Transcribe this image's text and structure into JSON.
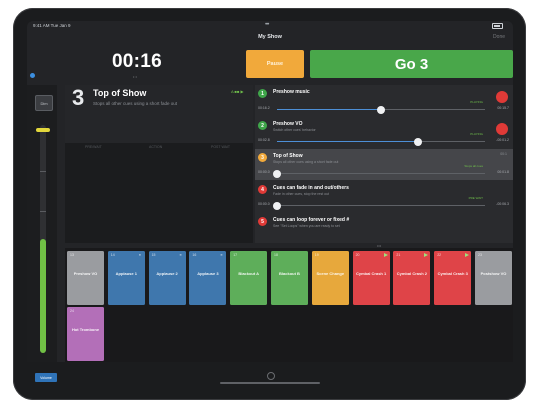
{
  "status_bar": {
    "time": "9:41 AM  Tue Jan 9",
    "dots": "•••"
  },
  "header": {
    "show_name": "My Show",
    "done_label": "Done",
    "clock": "00:16",
    "clock_dots": "• •"
  },
  "controls": {
    "pause_label": "Pause",
    "go_label": "Go 3"
  },
  "sidebar": {
    "dim_label": "Dim"
  },
  "current_cue": {
    "number": "3",
    "title": "Top of Show",
    "description": "Stops all other cues using a short fade out",
    "status": "A ■■ ▶",
    "columns": [
      "PRE/WAIT",
      "ACTION",
      "POST WAIT"
    ]
  },
  "cue_list": [
    {
      "number": "1",
      "color": "#3fa64a",
      "title": "Preshow music",
      "subtitle": "",
      "state": "PLAYING",
      "left_time": "00:16.2",
      "right_time": "00:15.7",
      "progress": 0.5,
      "action": "stop",
      "active": false
    },
    {
      "number": "2",
      "color": "#3fa64a",
      "title": "Preshow VO",
      "subtitle": "Switch other cues' behavior",
      "state": "PLAYING",
      "left_time": "00:02.8",
      "right_time": "-00:01.2",
      "progress": 0.68,
      "action": "stop",
      "active": false
    },
    {
      "number": "3",
      "color": "#f1a93b",
      "title": "Top of Show",
      "subtitle": "Stops all other cues using a short fade out",
      "state": "Stops all cues",
      "left_time": "00:00.0",
      "right_time": "00:01.8",
      "progress": 0.0,
      "action": "none",
      "active": true,
      "top_right": "00:1"
    },
    {
      "number": "4",
      "color": "#e03a37",
      "title": "Cues can fade in and out/others",
      "subtitle": "Fade in other cues, stop the rest out",
      "state": "PRE WAIT",
      "left_time": "00:00.0",
      "right_time": "-00:06.3",
      "progress": 0.0,
      "action": "play",
      "active": false
    },
    {
      "number": "5",
      "color": "#e03a37",
      "title": "Cues can loop forever or fixed #",
      "subtitle": "See \"Set Loops\" when you are ready to set",
      "state": "",
      "left_time": "",
      "right_time": "",
      "progress": 0.0,
      "action": "play",
      "active": false
    }
  ],
  "more_handle": "•••",
  "tiles": [
    {
      "number": "13",
      "label": "Preshow VO",
      "color": "#9a9ca0",
      "play": false,
      "vol": ""
    },
    {
      "number": "14",
      "label": "Applause 1",
      "color": "#3f77ad",
      "play": false,
      "vol": "≡"
    },
    {
      "number": "15",
      "label": "Applause 2",
      "color": "#3f77ad",
      "play": false,
      "vol": "≡"
    },
    {
      "number": "16",
      "label": "Applause 3",
      "color": "#3f77ad",
      "play": false,
      "vol": "≡"
    },
    {
      "number": "17",
      "label": "Blackout A",
      "color": "#5eae5a",
      "play": false,
      "vol": ""
    },
    {
      "number": "18",
      "label": "Blackout B",
      "color": "#5eae5a",
      "play": false,
      "vol": ""
    },
    {
      "number": "19",
      "label": "Scene Change",
      "color": "#e7a83c",
      "play": false,
      "vol": ""
    },
    {
      "number": "20",
      "label": "Cymbal Crash 1",
      "color": "#df4448",
      "play": true,
      "vol": ""
    },
    {
      "number": "21",
      "label": "Cymbal Crash 2",
      "color": "#df4448",
      "play": true,
      "vol": ""
    },
    {
      "number": "22",
      "label": "Cymbal Crash 3",
      "color": "#df4448",
      "play": true,
      "vol": ""
    },
    {
      "number": "23",
      "label": "Postshow VO",
      "color": "#9a9ca0",
      "play": false,
      "vol": ""
    },
    {
      "number": "24",
      "label": "Hot Trombone",
      "color": "#b36fb8",
      "play": false,
      "vol": ""
    }
  ],
  "footer": {
    "volume_label": "Volume"
  }
}
